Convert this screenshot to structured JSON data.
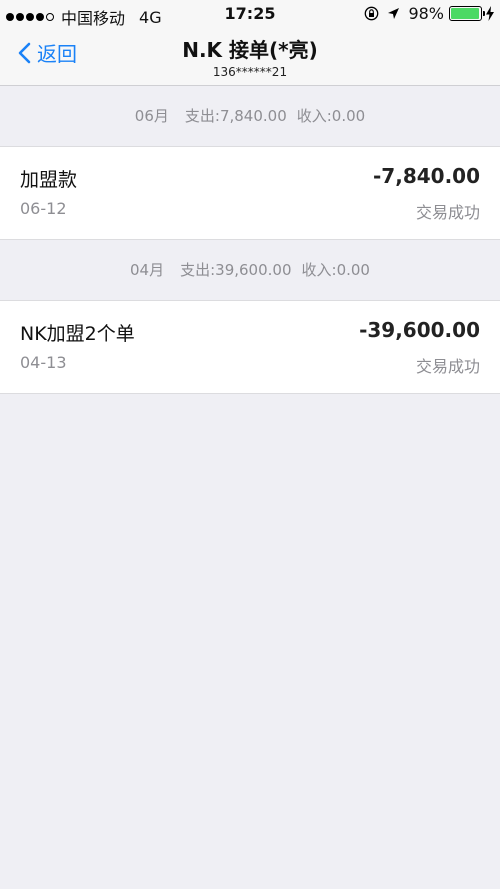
{
  "status_bar": {
    "carrier": "中国移动",
    "network": "4G",
    "time": "17:25",
    "battery": "98%",
    "battery_level": 0.98,
    "battery_color": "#4cd964"
  },
  "nav": {
    "back_label": "返回",
    "title": "N.K 接单(*亮)",
    "subtitle": "136******21",
    "accent": "#1a82f7"
  },
  "groups": [
    {
      "month": "06月",
      "expense": "支出:7,840.00",
      "income": "收入:0.00",
      "items": [
        {
          "name": "加盟款",
          "date": "06-12",
          "amount": "-7,840.00",
          "status": "交易成功"
        }
      ]
    },
    {
      "month": "04月",
      "expense": "支出:39,600.00",
      "income": "收入:0.00",
      "items": [
        {
          "name": "NK加盟2个单",
          "date": "04-13",
          "amount": "-39,600.00",
          "status": "交易成功"
        }
      ]
    }
  ]
}
